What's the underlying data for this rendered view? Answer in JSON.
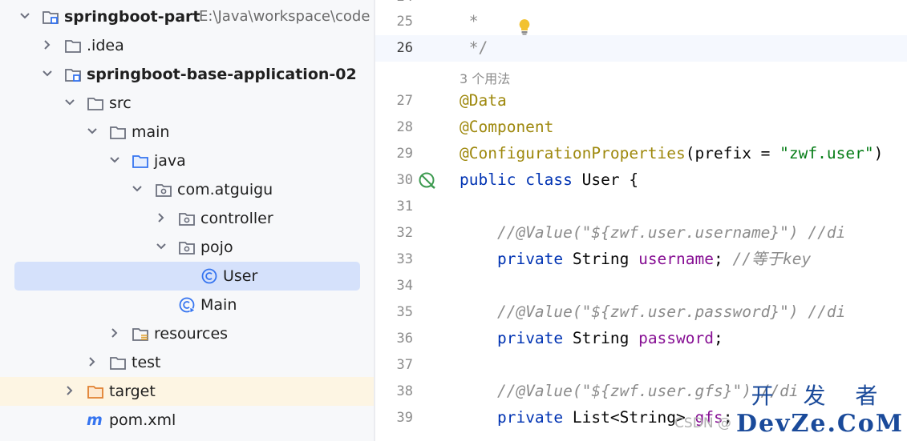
{
  "tree": {
    "project": {
      "name": "springboot-part",
      "path": "E:\\Java\\workspace\\code"
    },
    "items": [
      {
        "label": ".idea"
      },
      {
        "label": "springboot-base-application-02"
      },
      {
        "label": "src"
      },
      {
        "label": "main"
      },
      {
        "label": "java"
      },
      {
        "label": "com.atguigu"
      },
      {
        "label": "controller"
      },
      {
        "label": "pojo"
      },
      {
        "label": "User"
      },
      {
        "label": "Main"
      },
      {
        "label": "resources"
      },
      {
        "label": "test"
      },
      {
        "label": "target"
      },
      {
        "label": "pom.xml"
      }
    ]
  },
  "editor": {
    "usages_hint": "3 个用法",
    "lines": [
      {
        "n": "25",
        "t": " *"
      },
      {
        "n": "26",
        "t": " */"
      },
      {
        "n": "27",
        "t": "@Data"
      },
      {
        "n": "28",
        "t": "@Component"
      },
      {
        "n": "29",
        "a": "@ConfigurationProperties",
        "b": "(prefix = ",
        "s": "\"zwf.user\"",
        "c": ")"
      },
      {
        "n": "30",
        "k1": "public",
        "k2": "class",
        "t": " User {"
      },
      {
        "n": "31"
      },
      {
        "n": "32",
        "t": "    //@Value(\"${zwf.user.username}\") //di"
      },
      {
        "n": "33",
        "k": "private",
        "ty": " String ",
        "f": "username",
        "e": "; ",
        "c": "//等于key"
      },
      {
        "n": "34"
      },
      {
        "n": "35",
        "t": "    //@Value(\"${zwf.user.password}\") //di"
      },
      {
        "n": "36",
        "k": "private",
        "ty": " String ",
        "f": "password",
        "e": ";"
      },
      {
        "n": "37"
      },
      {
        "n": "38",
        "t": "    //@Value(\"${zwf.user.gfs}\") //di"
      },
      {
        "n": "39",
        "k": "private",
        "ty": " List<String> ",
        "f": "gfs",
        "e": ";"
      }
    ]
  },
  "watermark": {
    "small": "CSDN @",
    "top": "开 发 者",
    "big": "DevZe.CoM"
  },
  "colors": {
    "tree_bg": "#f7f8fa",
    "selection": "#d5e1fb",
    "excluded": "#fdf5e3",
    "keyword": "#0033b3",
    "annotation": "#9e880d",
    "string": "#067d17",
    "field": "#871094"
  }
}
